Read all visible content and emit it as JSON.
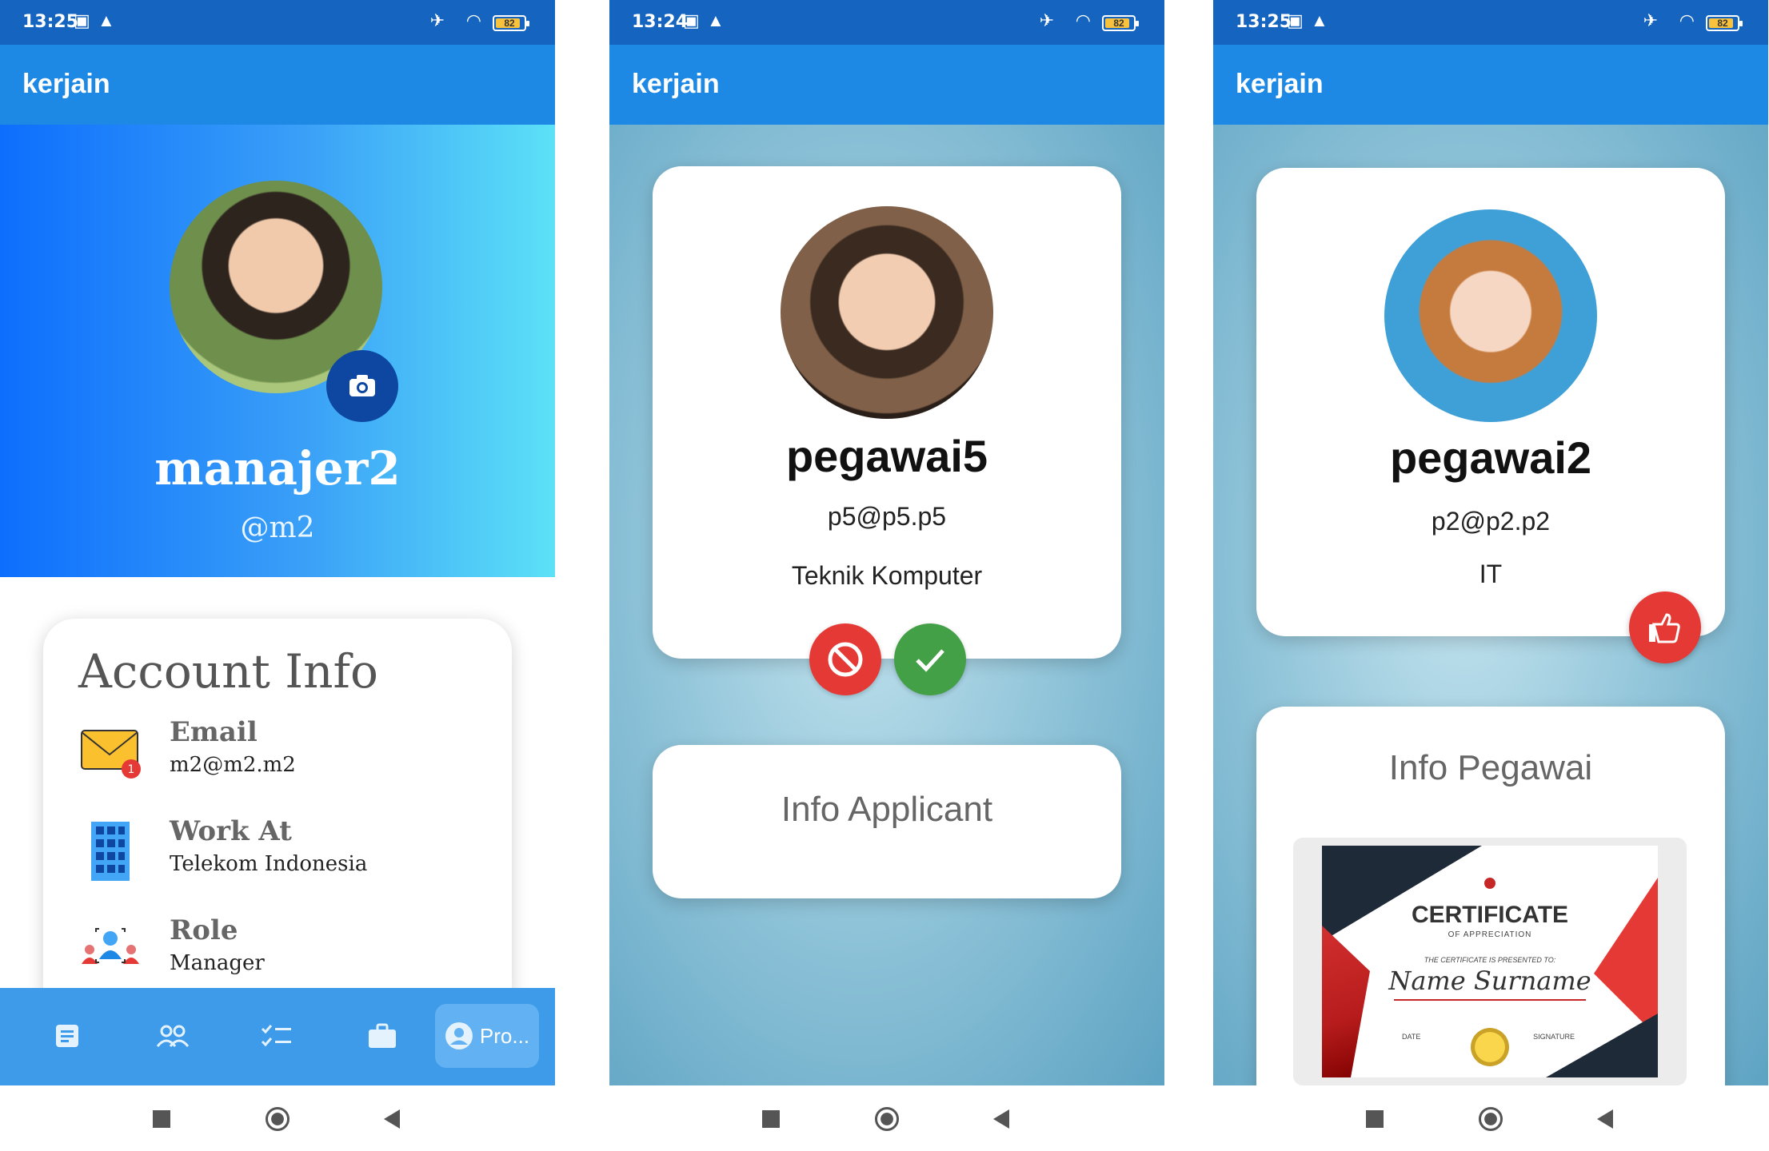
{
  "status": {
    "p1_time": "13:25",
    "p2_time": "13:24",
    "p3_time": "13:25",
    "battery": "82"
  },
  "app_title": "kerjain",
  "profile": {
    "name": "manajer2",
    "handle": "@m2",
    "account_info_title": "Account Info",
    "email_label": "Email",
    "email_value": "m2@m2.m2",
    "work_label": "Work At",
    "work_value": "Telekom Indonesia",
    "role_label": "Role",
    "role_value": "Manager",
    "email_badge": "1"
  },
  "bottom_nav": {
    "items": [
      "document-icon",
      "people-icon",
      "checklist-icon",
      "briefcase-icon",
      "profile-icon"
    ],
    "active_label": "Pro..."
  },
  "applicant": {
    "name": "pegawai5",
    "email": "p5@p5.p5",
    "department": "Teknik Komputer",
    "info_title": "Info Applicant"
  },
  "employee": {
    "name": "pegawai2",
    "email": "p2@p2.p2",
    "department": "IT",
    "info_title": "Info Pegawai"
  },
  "certificate": {
    "title": "CERTIFICATE",
    "subtitle": "OF APPRECIATION",
    "presented": "THE CERTIFICATE IS PRESENTED TO:",
    "name": "Name Surname",
    "date_label": "DATE",
    "signature_label": "SIGNATURE"
  },
  "colors": {
    "status_bar": "#1565c0",
    "app_bar": "#1e88e5",
    "reject": "#e53935",
    "accept": "#43a047"
  }
}
